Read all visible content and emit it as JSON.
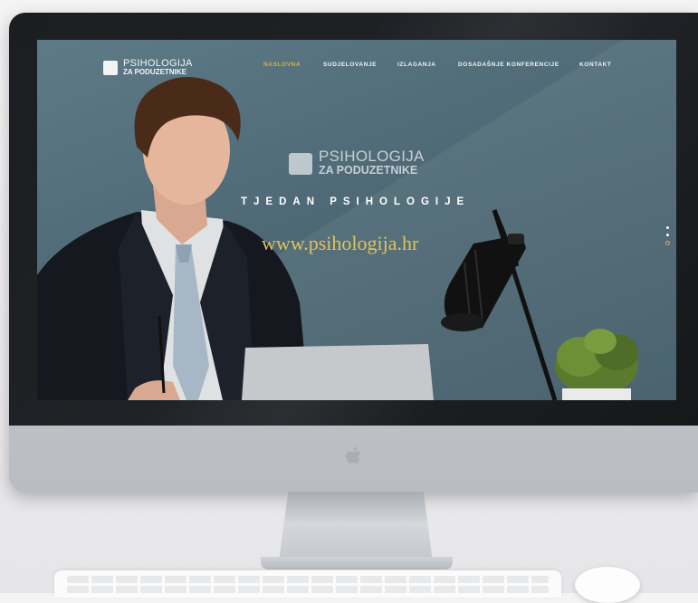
{
  "site": {
    "logo": {
      "line1": "PSIHOLOGIJA",
      "line2": "ZA PODUZETNIKE"
    },
    "nav": [
      {
        "label": "NASLOVNA",
        "active": true
      },
      {
        "label": "SUDJELOVANJE",
        "active": false
      },
      {
        "label": "IZLAGANJA",
        "active": false
      },
      {
        "label": "DOSADAŠNJE KONFERENCIJE",
        "active": false
      },
      {
        "label": "KONTAKT",
        "active": false
      }
    ],
    "hero": {
      "logo_line1": "PSIHOLOGIJA",
      "logo_line2": "ZA PODUZETNIKE",
      "headline": "TJEDAN PSIHOLOGIJE",
      "url": "www.psihologija.hr"
    },
    "slider": {
      "slides": 3,
      "active_index": 2
    }
  },
  "colors": {
    "accent": "#d9b144",
    "url_text": "#e2c25a",
    "hero_background": "#4d6874",
    "bezel": "#1b1d20",
    "monitor_body": "#c4c7cb"
  },
  "icons": {
    "logo": "open-book-icon",
    "apple": "apple-logo-icon"
  }
}
